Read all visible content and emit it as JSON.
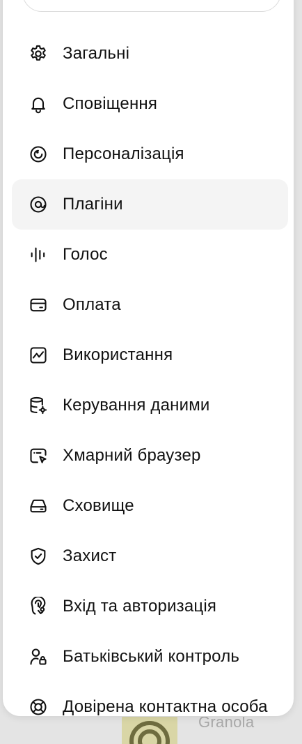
{
  "background": {
    "app_label": "Granola"
  },
  "menu": {
    "active_index": 3,
    "items": [
      {
        "label": "Загальні",
        "icon": "gear-icon"
      },
      {
        "label": "Сповіщення",
        "icon": "bell-icon"
      },
      {
        "label": "Персоналізація",
        "icon": "personalization-icon"
      },
      {
        "label": "Плагіни",
        "icon": "plugins-icon"
      },
      {
        "label": "Голос",
        "icon": "voice-waveform-icon"
      },
      {
        "label": "Оплата",
        "icon": "credit-card-icon"
      },
      {
        "label": "Використання",
        "icon": "usage-chart-icon"
      },
      {
        "label": "Керування даними",
        "icon": "database-gear-icon"
      },
      {
        "label": "Хмарний браузер",
        "icon": "cloud-browser-icon"
      },
      {
        "label": "Сховище",
        "icon": "storage-drive-icon"
      },
      {
        "label": "Захист",
        "icon": "shield-check-icon"
      },
      {
        "label": "Вхід та авторизація",
        "icon": "passkey-icon"
      },
      {
        "label": "Батьківський контроль",
        "icon": "parental-control-icon"
      },
      {
        "label": "Довірена контактна особа",
        "icon": "lifebuoy-icon"
      }
    ]
  },
  "colors": {
    "text": "#111111",
    "active_bg": "#f4f4f4",
    "panel_bg": "#ffffff",
    "backdrop": "#e4e4e4"
  }
}
